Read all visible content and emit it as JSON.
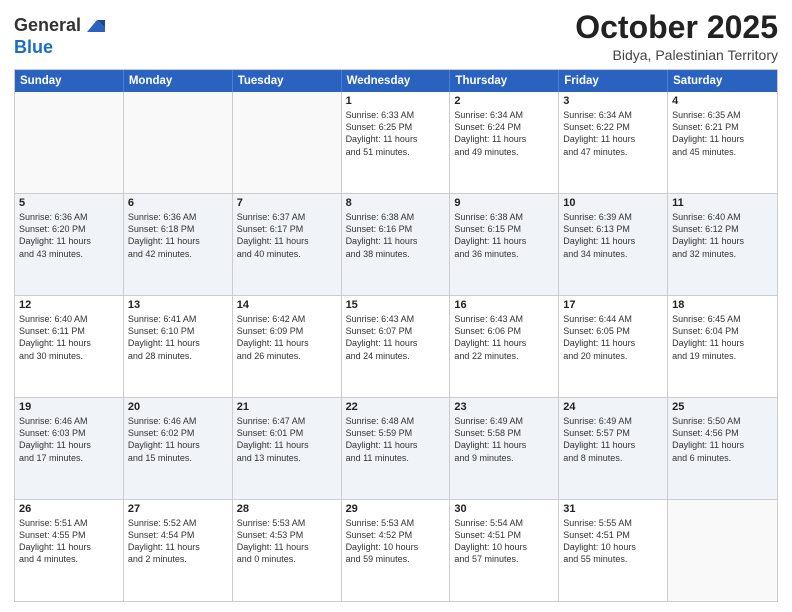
{
  "logo": {
    "general": "General",
    "blue": "Blue"
  },
  "header": {
    "month": "October 2025",
    "location": "Bidya, Palestinian Territory"
  },
  "days": [
    "Sunday",
    "Monday",
    "Tuesday",
    "Wednesday",
    "Thursday",
    "Friday",
    "Saturday"
  ],
  "weeks": [
    [
      {
        "day": "",
        "content": ""
      },
      {
        "day": "",
        "content": ""
      },
      {
        "day": "",
        "content": ""
      },
      {
        "day": "1",
        "content": "Sunrise: 6:33 AM\nSunset: 6:25 PM\nDaylight: 11 hours\nand 51 minutes."
      },
      {
        "day": "2",
        "content": "Sunrise: 6:34 AM\nSunset: 6:24 PM\nDaylight: 11 hours\nand 49 minutes."
      },
      {
        "day": "3",
        "content": "Sunrise: 6:34 AM\nSunset: 6:22 PM\nDaylight: 11 hours\nand 47 minutes."
      },
      {
        "day": "4",
        "content": "Sunrise: 6:35 AM\nSunset: 6:21 PM\nDaylight: 11 hours\nand 45 minutes."
      }
    ],
    [
      {
        "day": "5",
        "content": "Sunrise: 6:36 AM\nSunset: 6:20 PM\nDaylight: 11 hours\nand 43 minutes."
      },
      {
        "day": "6",
        "content": "Sunrise: 6:36 AM\nSunset: 6:18 PM\nDaylight: 11 hours\nand 42 minutes."
      },
      {
        "day": "7",
        "content": "Sunrise: 6:37 AM\nSunset: 6:17 PM\nDaylight: 11 hours\nand 40 minutes."
      },
      {
        "day": "8",
        "content": "Sunrise: 6:38 AM\nSunset: 6:16 PM\nDaylight: 11 hours\nand 38 minutes."
      },
      {
        "day": "9",
        "content": "Sunrise: 6:38 AM\nSunset: 6:15 PM\nDaylight: 11 hours\nand 36 minutes."
      },
      {
        "day": "10",
        "content": "Sunrise: 6:39 AM\nSunset: 6:13 PM\nDaylight: 11 hours\nand 34 minutes."
      },
      {
        "day": "11",
        "content": "Sunrise: 6:40 AM\nSunset: 6:12 PM\nDaylight: 11 hours\nand 32 minutes."
      }
    ],
    [
      {
        "day": "12",
        "content": "Sunrise: 6:40 AM\nSunset: 6:11 PM\nDaylight: 11 hours\nand 30 minutes."
      },
      {
        "day": "13",
        "content": "Sunrise: 6:41 AM\nSunset: 6:10 PM\nDaylight: 11 hours\nand 28 minutes."
      },
      {
        "day": "14",
        "content": "Sunrise: 6:42 AM\nSunset: 6:09 PM\nDaylight: 11 hours\nand 26 minutes."
      },
      {
        "day": "15",
        "content": "Sunrise: 6:43 AM\nSunset: 6:07 PM\nDaylight: 11 hours\nand 24 minutes."
      },
      {
        "day": "16",
        "content": "Sunrise: 6:43 AM\nSunset: 6:06 PM\nDaylight: 11 hours\nand 22 minutes."
      },
      {
        "day": "17",
        "content": "Sunrise: 6:44 AM\nSunset: 6:05 PM\nDaylight: 11 hours\nand 20 minutes."
      },
      {
        "day": "18",
        "content": "Sunrise: 6:45 AM\nSunset: 6:04 PM\nDaylight: 11 hours\nand 19 minutes."
      }
    ],
    [
      {
        "day": "19",
        "content": "Sunrise: 6:46 AM\nSunset: 6:03 PM\nDaylight: 11 hours\nand 17 minutes."
      },
      {
        "day": "20",
        "content": "Sunrise: 6:46 AM\nSunset: 6:02 PM\nDaylight: 11 hours\nand 15 minutes."
      },
      {
        "day": "21",
        "content": "Sunrise: 6:47 AM\nSunset: 6:01 PM\nDaylight: 11 hours\nand 13 minutes."
      },
      {
        "day": "22",
        "content": "Sunrise: 6:48 AM\nSunset: 5:59 PM\nDaylight: 11 hours\nand 11 minutes."
      },
      {
        "day": "23",
        "content": "Sunrise: 6:49 AM\nSunset: 5:58 PM\nDaylight: 11 hours\nand 9 minutes."
      },
      {
        "day": "24",
        "content": "Sunrise: 6:49 AM\nSunset: 5:57 PM\nDaylight: 11 hours\nand 8 minutes."
      },
      {
        "day": "25",
        "content": "Sunrise: 5:50 AM\nSunset: 4:56 PM\nDaylight: 11 hours\nand 6 minutes."
      }
    ],
    [
      {
        "day": "26",
        "content": "Sunrise: 5:51 AM\nSunset: 4:55 PM\nDaylight: 11 hours\nand 4 minutes."
      },
      {
        "day": "27",
        "content": "Sunrise: 5:52 AM\nSunset: 4:54 PM\nDaylight: 11 hours\nand 2 minutes."
      },
      {
        "day": "28",
        "content": "Sunrise: 5:53 AM\nSunset: 4:53 PM\nDaylight: 11 hours\nand 0 minutes."
      },
      {
        "day": "29",
        "content": "Sunrise: 5:53 AM\nSunset: 4:52 PM\nDaylight: 10 hours\nand 59 minutes."
      },
      {
        "day": "30",
        "content": "Sunrise: 5:54 AM\nSunset: 4:51 PM\nDaylight: 10 hours\nand 57 minutes."
      },
      {
        "day": "31",
        "content": "Sunrise: 5:55 AM\nSunset: 4:51 PM\nDaylight: 10 hours\nand 55 minutes."
      },
      {
        "day": "",
        "content": ""
      }
    ]
  ]
}
